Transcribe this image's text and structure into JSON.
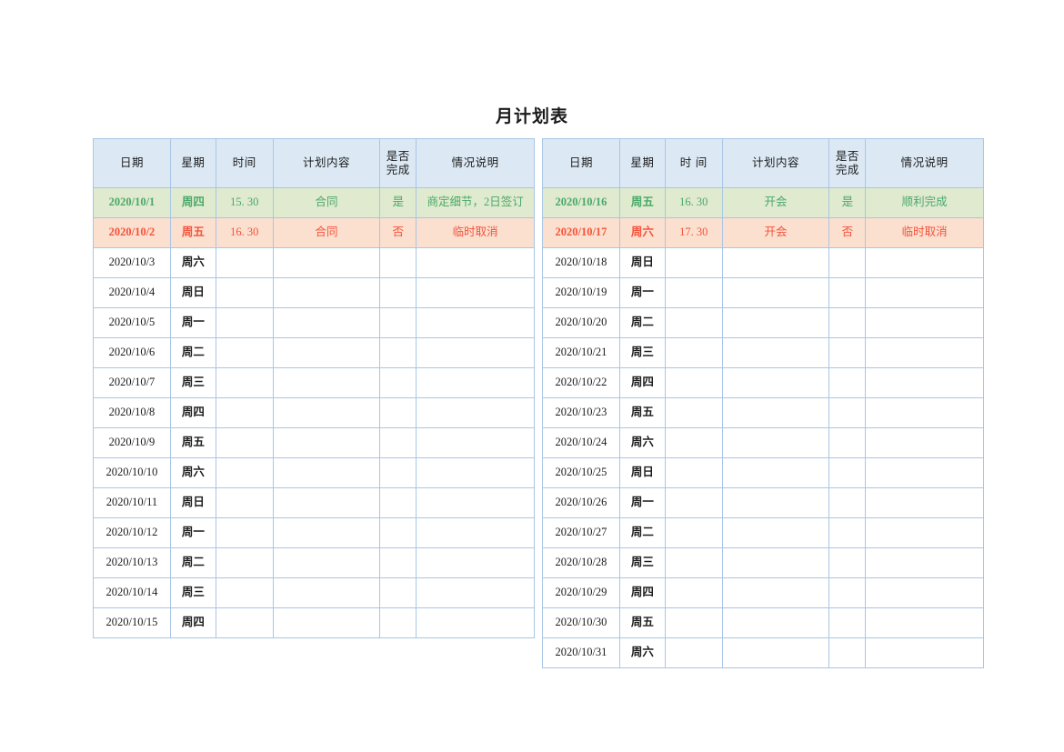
{
  "document": {
    "title": "月计划表"
  },
  "tables": [
    {
      "id": "left",
      "headers": {
        "date": "日期",
        "weekday": "星期",
        "time": "时间",
        "content": "计划内容",
        "done_line1": "是否",
        "done_line2": "完成",
        "note": "情况说明"
      },
      "rows": [
        {
          "date": "2020/10/1",
          "weekday": "周四",
          "time": "15. 30",
          "content": "合同",
          "done": "是",
          "note": "商定细节，2日签订",
          "state": "done"
        },
        {
          "date": "2020/10/2",
          "weekday": "周五",
          "time": "16. 30",
          "content": "合同",
          "done": "否",
          "note": "临时取消",
          "state": "cancel"
        },
        {
          "date": "2020/10/3",
          "weekday": "周六",
          "time": "",
          "content": "",
          "done": "",
          "note": "",
          "state": "plain"
        },
        {
          "date": "2020/10/4",
          "weekday": "周日",
          "time": "",
          "content": "",
          "done": "",
          "note": "",
          "state": "plain"
        },
        {
          "date": "2020/10/5",
          "weekday": "周一",
          "time": "",
          "content": "",
          "done": "",
          "note": "",
          "state": "plain"
        },
        {
          "date": "2020/10/6",
          "weekday": "周二",
          "time": "",
          "content": "",
          "done": "",
          "note": "",
          "state": "plain"
        },
        {
          "date": "2020/10/7",
          "weekday": "周三",
          "time": "",
          "content": "",
          "done": "",
          "note": "",
          "state": "plain"
        },
        {
          "date": "2020/10/8",
          "weekday": "周四",
          "time": "",
          "content": "",
          "done": "",
          "note": "",
          "state": "plain"
        },
        {
          "date": "2020/10/9",
          "weekday": "周五",
          "time": "",
          "content": "",
          "done": "",
          "note": "",
          "state": "plain"
        },
        {
          "date": "2020/10/10",
          "weekday": "周六",
          "time": "",
          "content": "",
          "done": "",
          "note": "",
          "state": "plain"
        },
        {
          "date": "2020/10/11",
          "weekday": "周日",
          "time": "",
          "content": "",
          "done": "",
          "note": "",
          "state": "plain"
        },
        {
          "date": "2020/10/12",
          "weekday": "周一",
          "time": "",
          "content": "",
          "done": "",
          "note": "",
          "state": "plain"
        },
        {
          "date": "2020/10/13",
          "weekday": "周二",
          "time": "",
          "content": "",
          "done": "",
          "note": "",
          "state": "plain"
        },
        {
          "date": "2020/10/14",
          "weekday": "周三",
          "time": "",
          "content": "",
          "done": "",
          "note": "",
          "state": "plain"
        },
        {
          "date": "2020/10/15",
          "weekday": "周四",
          "time": "",
          "content": "",
          "done": "",
          "note": "",
          "state": "plain"
        }
      ]
    },
    {
      "id": "right",
      "headers": {
        "date": "日期",
        "weekday": "星期",
        "time": "时 间",
        "content": "计划内容",
        "done_line1": "是否",
        "done_line2": "完成",
        "note": "情况说明"
      },
      "rows": [
        {
          "date": "2020/10/16",
          "weekday": "周五",
          "time": "16. 30",
          "content": "开会",
          "done": "是",
          "note": "顺利完成",
          "state": "done"
        },
        {
          "date": "2020/10/17",
          "weekday": "周六",
          "time": "17. 30",
          "content": "开会",
          "done": "否",
          "note": "临时取消",
          "state": "cancel"
        },
        {
          "date": "2020/10/18",
          "weekday": "周日",
          "time": "",
          "content": "",
          "done": "",
          "note": "",
          "state": "plain"
        },
        {
          "date": "2020/10/19",
          "weekday": "周一",
          "time": "",
          "content": "",
          "done": "",
          "note": "",
          "state": "plain"
        },
        {
          "date": "2020/10/20",
          "weekday": "周二",
          "time": "",
          "content": "",
          "done": "",
          "note": "",
          "state": "plain"
        },
        {
          "date": "2020/10/21",
          "weekday": "周三",
          "time": "",
          "content": "",
          "done": "",
          "note": "",
          "state": "plain"
        },
        {
          "date": "2020/10/22",
          "weekday": "周四",
          "time": "",
          "content": "",
          "done": "",
          "note": "",
          "state": "plain"
        },
        {
          "date": "2020/10/23",
          "weekday": "周五",
          "time": "",
          "content": "",
          "done": "",
          "note": "",
          "state": "plain"
        },
        {
          "date": "2020/10/24",
          "weekday": "周六",
          "time": "",
          "content": "",
          "done": "",
          "note": "",
          "state": "plain"
        },
        {
          "date": "2020/10/25",
          "weekday": "周日",
          "time": "",
          "content": "",
          "done": "",
          "note": "",
          "state": "plain"
        },
        {
          "date": "2020/10/26",
          "weekday": "周一",
          "time": "",
          "content": "",
          "done": "",
          "note": "",
          "state": "plain"
        },
        {
          "date": "2020/10/27",
          "weekday": "周二",
          "time": "",
          "content": "",
          "done": "",
          "note": "",
          "state": "plain"
        },
        {
          "date": "2020/10/28",
          "weekday": "周三",
          "time": "",
          "content": "",
          "done": "",
          "note": "",
          "state": "plain"
        },
        {
          "date": "2020/10/29",
          "weekday": "周四",
          "time": "",
          "content": "",
          "done": "",
          "note": "",
          "state": "plain"
        },
        {
          "date": "2020/10/30",
          "weekday": "周五",
          "time": "",
          "content": "",
          "done": "",
          "note": "",
          "state": "plain"
        },
        {
          "date": "2020/10/31",
          "weekday": "周六",
          "time": "",
          "content": "",
          "done": "",
          "note": "",
          "state": "plain"
        }
      ]
    }
  ],
  "colors": {
    "header_bg": "#dce9f5",
    "border": "#a9c6e4",
    "row_done_bg": "#dfeace",
    "row_done_text": "#4aa96a",
    "row_cancel_bg": "#fbdfcf",
    "row_cancel_text": "#f4543c",
    "page_bg": "#ffffff"
  }
}
